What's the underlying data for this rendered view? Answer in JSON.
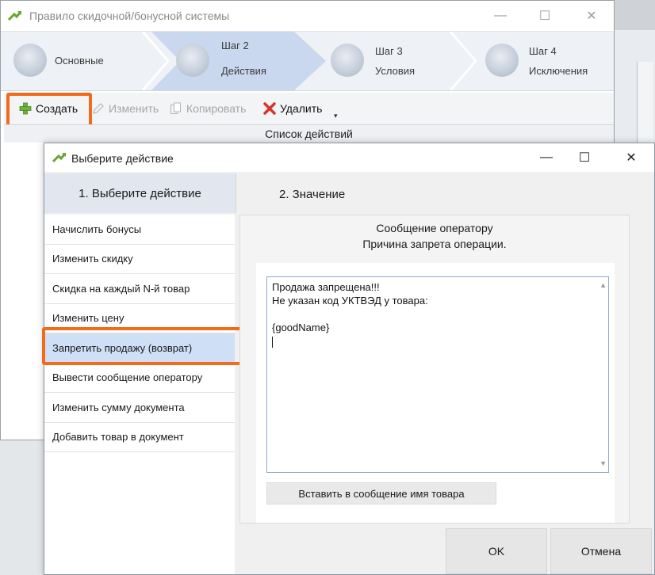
{
  "background_window": {
    "title": "Правило скидочной/бонусной системы",
    "steps": [
      {
        "line1": "",
        "line2": "Основные",
        "active": false
      },
      {
        "line1": "Шаг 2",
        "line2": "Действия",
        "active": true
      },
      {
        "line1": "Шаг 3",
        "line2": "Условия",
        "active": false
      },
      {
        "line1": "Шаг 4",
        "line2": "Исключения",
        "active": false
      }
    ],
    "toolbar": {
      "create_label": "Создать",
      "edit_label": "Изменить",
      "copy_label": "Копировать",
      "delete_label": "Удалить"
    },
    "list_header": "Список  действий"
  },
  "dialog": {
    "title": "Выберите действие",
    "tab1_label": "1. Выберите  действие",
    "tab2_label": "2. Значение",
    "actions": [
      "Начислить бонусы",
      "Изменить скидку",
      "Скидка на каждый N-й товар",
      "Изменить цену",
      "Запретить продажу (возврат)",
      "Вывести сообщение оператору",
      "Изменить сумму документа",
      "Добавить товар в документ"
    ],
    "selected_action_index": 4,
    "panel_title_1": "Сообщение оператору",
    "panel_title_2": "Причина запрета операции.",
    "message_text": "Продажа запрещена!!!\nНе указан код УКТВЭД у товара:\n\n{goodName}",
    "insert_button_label": "Вставить в сообщение имя товара",
    "ok_label": "OK",
    "cancel_label": "Отмена"
  },
  "colors": {
    "highlight": "#f26a1b",
    "selected_row": "#cfdff5",
    "active_step": "#c9d8ee"
  },
  "icons": [
    "app-arrow-icon",
    "minimize-icon",
    "maximize-icon",
    "close-icon",
    "plus-icon",
    "pencil-icon",
    "copy-icon",
    "delete-x-icon",
    "overflow-icon"
  ]
}
